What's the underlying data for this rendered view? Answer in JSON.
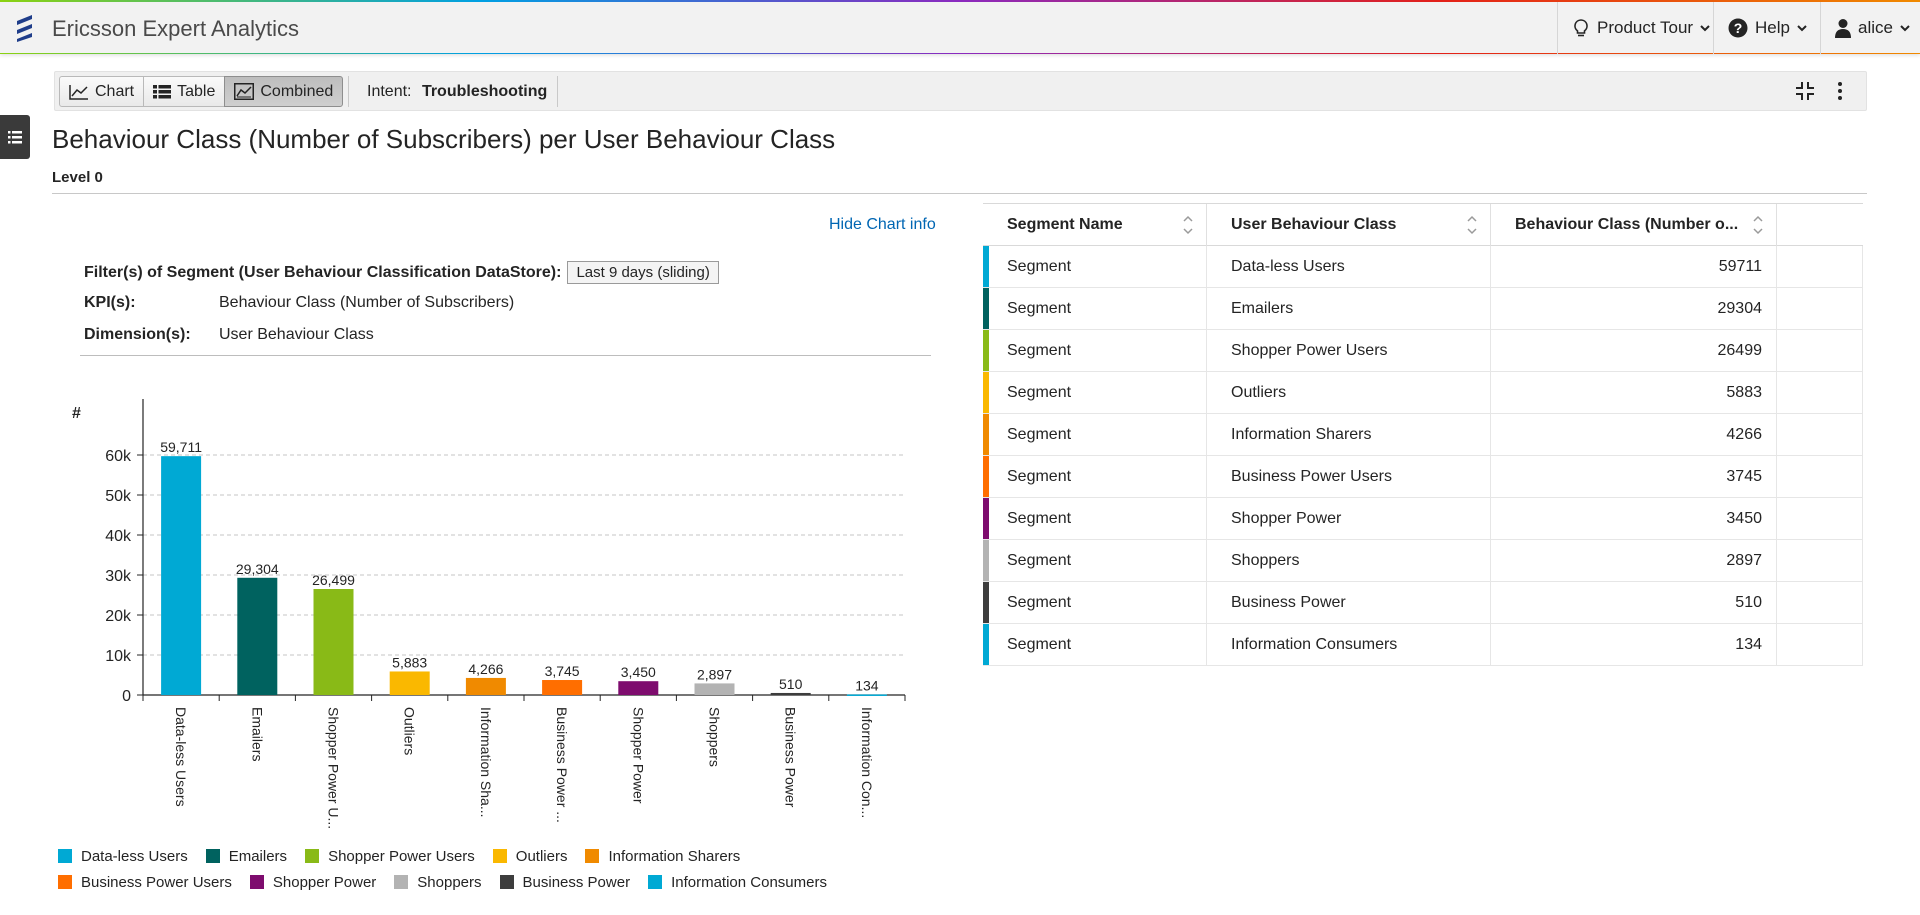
{
  "app": {
    "title": "Ericsson Expert Analytics",
    "product_tour_label": "Product Tour",
    "help_label": "Help",
    "user_label": "alice"
  },
  "toolbar": {
    "views": [
      {
        "label": "Chart",
        "icon": "line-chart-icon"
      },
      {
        "label": "Table",
        "icon": "table-grid-icon"
      },
      {
        "label": "Combined",
        "icon": "combined-view-icon",
        "active": true
      }
    ],
    "intent_label": "Intent:",
    "intent_value": "Troubleshooting"
  },
  "page": {
    "title": "Behaviour Class (Number of Subscribers) per User Behaviour Class",
    "level": "Level 0"
  },
  "chart_info": {
    "hide_label": "Hide Chart info",
    "filter_label": "Filter(s) of Segment (User Behaviour Classification DataStore):",
    "filter_value": "Last 9 days (sliding)",
    "kpi_label": "KPI(s):",
    "kpi_value": "Behaviour Class (Number of Subscribers)",
    "dimension_label": "Dimension(s):",
    "dimension_value": "User Behaviour Class"
  },
  "chart_data": {
    "type": "bar",
    "ylabel": "#",
    "ylim": [
      0,
      72000
    ],
    "yticks": [
      "0",
      "10k",
      "20k",
      "30k",
      "40k",
      "50k",
      "60k"
    ],
    "ytick_values": [
      0,
      10000,
      20000,
      30000,
      40000,
      50000,
      60000
    ],
    "categories": [
      "Data-less Users",
      "Emailers",
      "Shopper Power U...",
      "Outliers",
      "Information Sha...",
      "Business Power ...",
      "Shopper Power",
      "Shoppers",
      "Business Power",
      "Information Con..."
    ],
    "values": [
      59711,
      29304,
      26499,
      5883,
      4266,
      3745,
      3450,
      2897,
      510,
      134
    ],
    "value_labels": [
      "59,711",
      "29,304",
      "26,499",
      "5,883",
      "4,266",
      "3,745",
      "3,450",
      "2,897",
      "510",
      "134"
    ],
    "colors": [
      "#00a9d4",
      "#00625f",
      "#89ba17",
      "#fab800",
      "#f08a00",
      "#ff6e00",
      "#7e0c6e",
      "#b3b3b3",
      "#3d3d3d",
      "#00a9d4"
    ],
    "grid": true,
    "legend_position": "bottom"
  },
  "legend": [
    {
      "label": "Data-less Users",
      "color": "#00a9d4"
    },
    {
      "label": "Emailers",
      "color": "#00625f"
    },
    {
      "label": "Shopper Power Users",
      "color": "#89ba17"
    },
    {
      "label": "Outliers",
      "color": "#fab800"
    },
    {
      "label": "Information Sharers",
      "color": "#f08a00"
    },
    {
      "label": "Business Power Users",
      "color": "#ff6e00"
    },
    {
      "label": "Shopper Power",
      "color": "#7e0c6e"
    },
    {
      "label": "Shoppers",
      "color": "#b3b3b3"
    },
    {
      "label": "Business Power",
      "color": "#3d3d3d"
    },
    {
      "label": "Information Consumers",
      "color": "#00a9d4"
    }
  ],
  "table": {
    "columns": [
      "Segment Name",
      "User Behaviour Class",
      "Behaviour Class (Number o..."
    ],
    "rows": [
      {
        "segment": "Segment",
        "class": "Data-less Users",
        "value": "59711",
        "color": "#00a9d4"
      },
      {
        "segment": "Segment",
        "class": "Emailers",
        "value": "29304",
        "color": "#00625f"
      },
      {
        "segment": "Segment",
        "class": "Shopper Power Users",
        "value": "26499",
        "color": "#89ba17"
      },
      {
        "segment": "Segment",
        "class": "Outliers",
        "value": "5883",
        "color": "#fab800"
      },
      {
        "segment": "Segment",
        "class": "Information Sharers",
        "value": "4266",
        "color": "#f08a00"
      },
      {
        "segment": "Segment",
        "class": "Business Power Users",
        "value": "3745",
        "color": "#ff6e00"
      },
      {
        "segment": "Segment",
        "class": "Shopper Power",
        "value": "3450",
        "color": "#7e0c6e"
      },
      {
        "segment": "Segment",
        "class": "Shoppers",
        "value": "2897",
        "color": "#b3b3b3"
      },
      {
        "segment": "Segment",
        "class": "Business Power",
        "value": "510",
        "color": "#3d3d3d"
      },
      {
        "segment": "Segment",
        "class": "Information Consumers",
        "value": "134",
        "color": "#00a9d4"
      }
    ]
  }
}
